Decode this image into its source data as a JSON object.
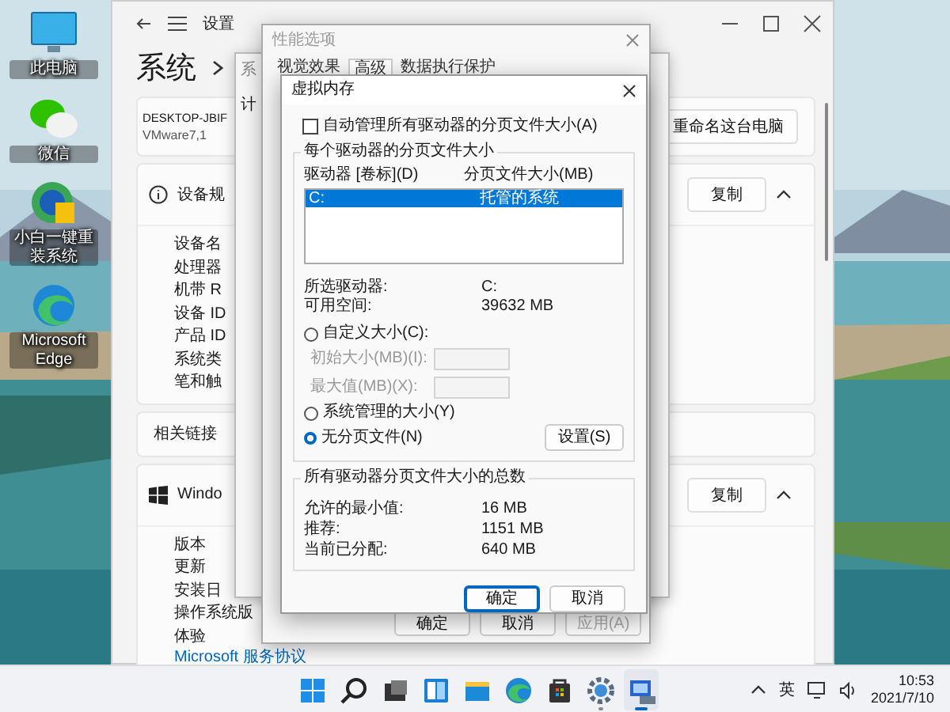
{
  "desktop": {
    "icons": [
      {
        "kind": "computer",
        "label": "此电脑"
      },
      {
        "kind": "chat",
        "label": "微信"
      },
      {
        "kind": "installer",
        "label": "小白一键重装系统"
      },
      {
        "kind": "edge",
        "label": "Microsoft Edge"
      }
    ]
  },
  "settings_window": {
    "title": "设置",
    "breadcrumb": "系统",
    "device_card": {
      "name": "DESKTOP-JBIF",
      "model": "VMware7,1",
      "button": "重命名这台电脑"
    },
    "sections": [
      {
        "kind": "info",
        "heading": "设备规",
        "button": "复制",
        "expanded": true,
        "rows": [
          "设备名",
          "处理器",
          "机带 R",
          "设备 ID",
          "产品 ID",
          "系统类",
          "笔和触"
        ]
      },
      {
        "kind": "windows",
        "heading": "Windo",
        "button": "复制",
        "expanded": true,
        "rows": [
          "版本",
          "更新",
          "安装日",
          "操作系统版",
          "体验"
        ],
        "link": "Microsoft 服务协议"
      }
    ],
    "related_links": "相关链接"
  },
  "system_properties": {
    "title": "系",
    "tab": "计"
  },
  "performance_options": {
    "title": "性能选项",
    "tabs": [
      {
        "label": "视觉效果",
        "selected": false
      },
      {
        "label": "高级",
        "selected": true
      },
      {
        "label": "数据执行保护",
        "selected": false
      }
    ],
    "buttons": [
      {
        "label": "确定",
        "disabled": false
      },
      {
        "label": "取消",
        "disabled": false
      },
      {
        "label": "应用(A)",
        "disabled": true
      }
    ]
  },
  "virtual_memory": {
    "title": "虚拟内存",
    "auto_manage": {
      "label": "自动管理所有驱动器的分页文件大小(A)",
      "checked": false
    },
    "group_title": "每个驱动器的分页文件大小",
    "columns": [
      "驱动器 [卷标](D)",
      "分页文件大小(MB)"
    ],
    "drives": [
      {
        "drive": "C:",
        "size": "托管的系统",
        "selected": true
      }
    ],
    "selected_drive": {
      "label": "所选驱动器:",
      "value": "C:"
    },
    "free_space": {
      "label": "可用空间:",
      "value": "39632 MB"
    },
    "options": [
      {
        "label": "自定义大小(C):",
        "selected": false
      },
      {
        "label": "系统管理的大小(Y)",
        "selected": false
      },
      {
        "label": "无分页文件(N)",
        "selected": true
      }
    ],
    "fields": [
      {
        "label": "初始大小(MB)(I):",
        "disabled": true
      },
      {
        "label": "最大值(MB)(X):",
        "disabled": true
      }
    ],
    "set_button": "设置(S)",
    "totals_title": "所有驱动器分页文件大小的总数",
    "totals": [
      {
        "label": "允许的最小值:",
        "value": "16 MB"
      },
      {
        "label": "推荐:",
        "value": "1151 MB"
      },
      {
        "label": "当前已分配:",
        "value": "640 MB"
      }
    ],
    "buttons": [
      {
        "label": "确定",
        "default": true
      },
      {
        "label": "取消",
        "default": false
      }
    ]
  },
  "taskbar": {
    "apps": [
      {
        "kind": "start",
        "running": false,
        "selected": false
      },
      {
        "kind": "search",
        "running": false,
        "selected": false
      },
      {
        "kind": "taskview",
        "running": false,
        "selected": false
      },
      {
        "kind": "widgets",
        "running": false,
        "selected": false
      },
      {
        "kind": "explorer",
        "running": false,
        "selected": false
      },
      {
        "kind": "edge",
        "running": false,
        "selected": false
      },
      {
        "kind": "store",
        "running": false,
        "selected": false
      },
      {
        "kind": "settings",
        "running": true,
        "selected": false
      },
      {
        "kind": "remote",
        "running": true,
        "selected": true
      }
    ],
    "input_method": "英",
    "time": "10:53",
    "date": "2021/7/10"
  }
}
